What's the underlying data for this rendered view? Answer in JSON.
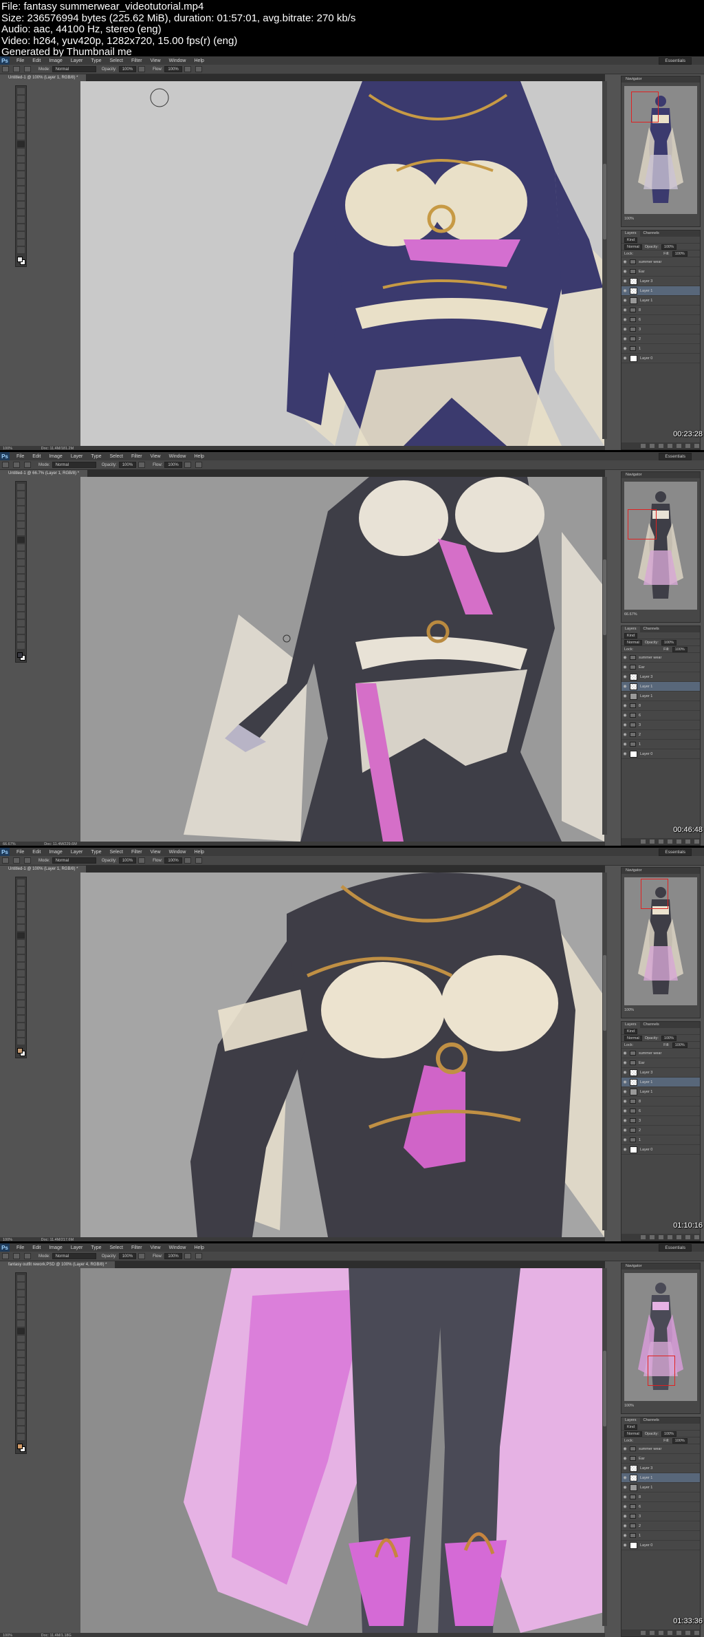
{
  "header": {
    "lines": [
      "File: fantasy summerwear_videotutorial.mp4",
      "Size: 236576994 bytes (225.62 MiB), duration: 01:57:01, avg.bitrate: 270 kb/s",
      "Audio: aac, 44100 Hz, stereo (eng)",
      "Video: h264, yuv420p, 1282x720, 15.00 fps(r) (eng)",
      "Generated by Thumbnail me"
    ]
  },
  "menu": {
    "logo": "Ps",
    "items": [
      "File",
      "Edit",
      "Image",
      "Layer",
      "Type",
      "Select",
      "Filter",
      "View",
      "Window",
      "Help"
    ],
    "workspace": "Essentials"
  },
  "options": {
    "mode_label": "Mode:",
    "mode_value": "Normal",
    "opacity_label": "Opacity:",
    "opacity_value": "100%",
    "flow_label": "Flow:",
    "flow_value": "100%"
  },
  "frames": [
    {
      "doc_tab": "Untitled-1 @ 100% (Layer 1, RGB/8) *",
      "status_zoom": "100%",
      "status_doc": "Doc: 11.4M/181.2M",
      "nav_zoom": "100%",
      "timestamp": "00:23:28",
      "colors": {
        "bodysuit": "#3b3a6e",
        "cloth": "#e9e0c8",
        "accent": "#d46fd0",
        "gold": "#c79a45",
        "fg": "#e8e8e8"
      }
    },
    {
      "doc_tab": "Untitled-1 @ 66.7% (Layer 1, RGB/8) *",
      "status_zoom": "66.67%",
      "status_doc": "Doc: 11.4M/229.6M",
      "nav_zoom": "66.67%",
      "timestamp": "00:46:48",
      "colors": {
        "bodysuit": "#3e3e47",
        "cloth": "#e8e2d6",
        "accent": "#d56fc8",
        "gold": "#b98a40",
        "fg": "#3c3c45"
      }
    },
    {
      "doc_tab": "Untitled-1 @ 100% (Layer 1, RGB/8) *",
      "status_zoom": "100%",
      "status_doc": "Doc: 11.4M/217.6M",
      "nav_zoom": "100%",
      "timestamp": "01:10:16",
      "colors": {
        "bodysuit": "#3e3d46",
        "cloth": "#ece3cf",
        "accent": "#d064c8",
        "gold": "#c09044",
        "fg": "#c49a72"
      }
    },
    {
      "doc_tab": "fantasy outfit rework.PSD @ 100% (Layer 4, RGB/8) *",
      "status_zoom": "100%",
      "status_doc": "Doc: 11.4M/1.18G",
      "nav_zoom": "100%",
      "timestamp": "01:33:36",
      "colors": {
        "bodysuit": "#4a4a56",
        "cloth": "#e6b2e4",
        "accent": "#d56ad6",
        "gold": "#c7853f",
        "fg": "#d19a66"
      }
    }
  ],
  "panels": {
    "navigator_title": "Navigator",
    "layers_tab": "Layers",
    "channels_tab": "Channels",
    "kind_label": "Kind",
    "blend_value": "Normal",
    "opacity_label": "Opacity:",
    "opacity_value": "100%",
    "lock_label": "Lock:",
    "fill_label": "Fill:",
    "fill_value": "100%",
    "layers": [
      {
        "name": "summer wear",
        "type": "folder"
      },
      {
        "name": "Ear",
        "type": "folder"
      },
      {
        "name": "Layer 3",
        "type": "layer"
      },
      {
        "name": "Layer 1",
        "type": "layer",
        "selected": true
      },
      {
        "name": "Layer 1",
        "type": "dark"
      },
      {
        "name": "8",
        "type": "folder"
      },
      {
        "name": "6",
        "type": "folder"
      },
      {
        "name": "3",
        "type": "folder"
      },
      {
        "name": "2",
        "type": "folder"
      },
      {
        "name": "1",
        "type": "folder"
      },
      {
        "name": "Layer 0",
        "type": "white"
      }
    ]
  }
}
